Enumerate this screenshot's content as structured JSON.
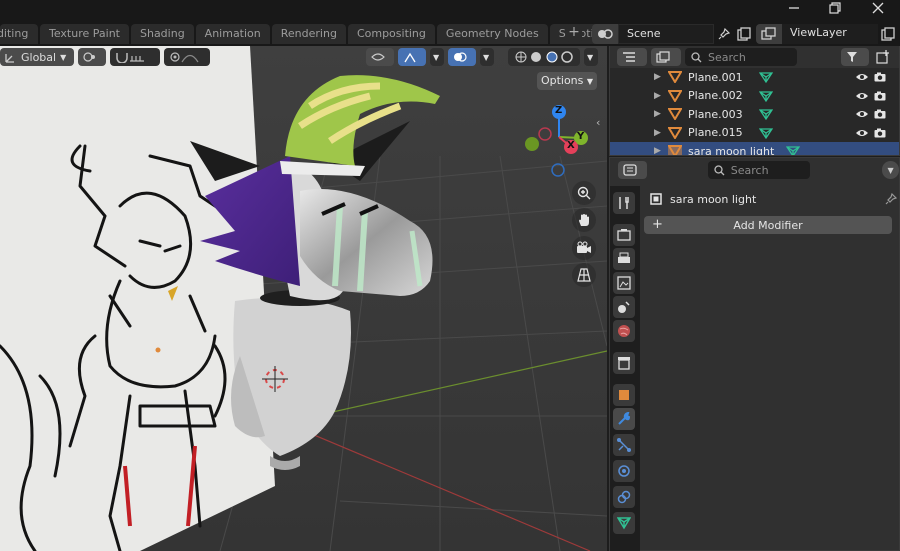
{
  "workspace_tabs": [
    "Editing",
    "Texture Paint",
    "Shading",
    "Animation",
    "Rendering",
    "Compositing",
    "Geometry Nodes",
    "Scripting"
  ],
  "add_tab_label": "+",
  "scene": {
    "name": "Scene"
  },
  "view_layer": {
    "name": "ViewLayer"
  },
  "viewport": {
    "transform_orientation": "Global",
    "options_label": "Options",
    "gizmo_axes": {
      "x": "X",
      "y": "Y",
      "z": "Z"
    }
  },
  "outliner": {
    "search_placeholder": "Search",
    "items": [
      {
        "name": "Plane.001"
      },
      {
        "name": "Plane.002"
      },
      {
        "name": "Plane.003"
      },
      {
        "name": "Plane.015"
      },
      {
        "name": "sara moon light"
      }
    ]
  },
  "properties": {
    "search_placeholder": "Search",
    "object_name": "sara moon light",
    "add_modifier_label": "Add Modifier"
  },
  "colors": {
    "accent_blue": "#4772b3",
    "axis_x": "#e4405a",
    "axis_y": "#7fb52c",
    "axis_z": "#2f85ef",
    "mesh_green": "#30c093",
    "object_orange": "#e08a3c"
  }
}
